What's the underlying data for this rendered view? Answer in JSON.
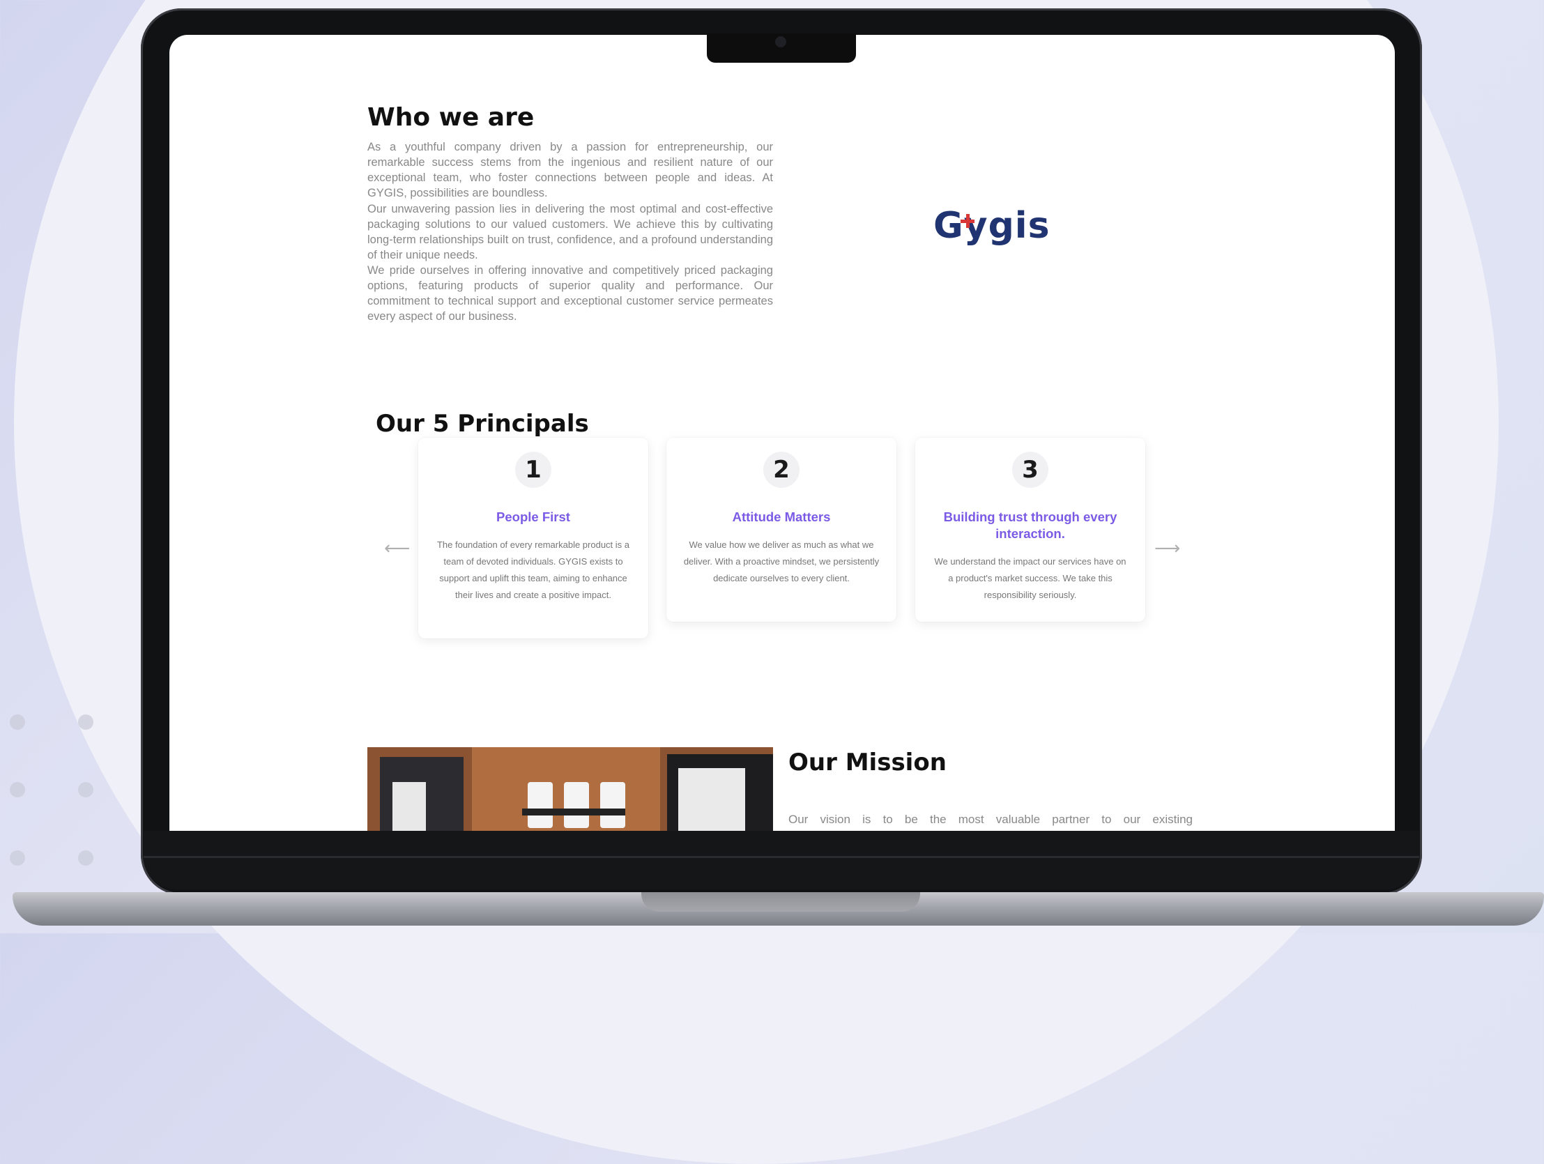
{
  "brand": {
    "logo_text": "Gygis",
    "logo_accent_color": "#d93636",
    "logo_color": "#1f3470"
  },
  "who_we_are": {
    "title": "Who we are",
    "paragraphs": [
      "As a youthful company driven by a passion for entrepreneurship, our remarkable success stems from the ingenious and resilient nature of our exceptional team, who foster connections between people and ideas. At GYGIS, possibilities are boundless.",
      "Our unwavering passion lies in delivering the most optimal and cost-effective packaging solutions to our valued customers. We achieve this by cultivating long-term relationships built on trust, confidence, and a profound understanding of their unique needs.",
      "We pride ourselves in offering innovative and competitively priced packaging options, featuring products of superior quality and performance. Our commitment to technical support and exceptional customer service permeates every aspect of our business."
    ]
  },
  "principals": {
    "title": "Our 5 Principals",
    "prev_icon": "arrow-left-icon",
    "next_icon": "arrow-right-icon",
    "cards": [
      {
        "number": "1",
        "title": "People First",
        "description": "The foundation of every remarkable product is a team of devoted individuals. GYGIS exists to support and uplift this team, aiming to enhance their lives and create a positive impact."
      },
      {
        "number": "2",
        "title": "Attitude Matters",
        "description": "We value how we deliver as much as what we deliver. With a proactive mindset, we persistently dedicate ourselves to every client."
      },
      {
        "number": "3",
        "title": "Building trust through every interaction.",
        "description": "We understand the impact our services have on a product's market success. We take this responsibility seriously."
      }
    ],
    "accent_color": "#7b5be6"
  },
  "mission": {
    "title": "Our Mission",
    "text": "Our vision is to be the most valuable partner to our existing"
  }
}
